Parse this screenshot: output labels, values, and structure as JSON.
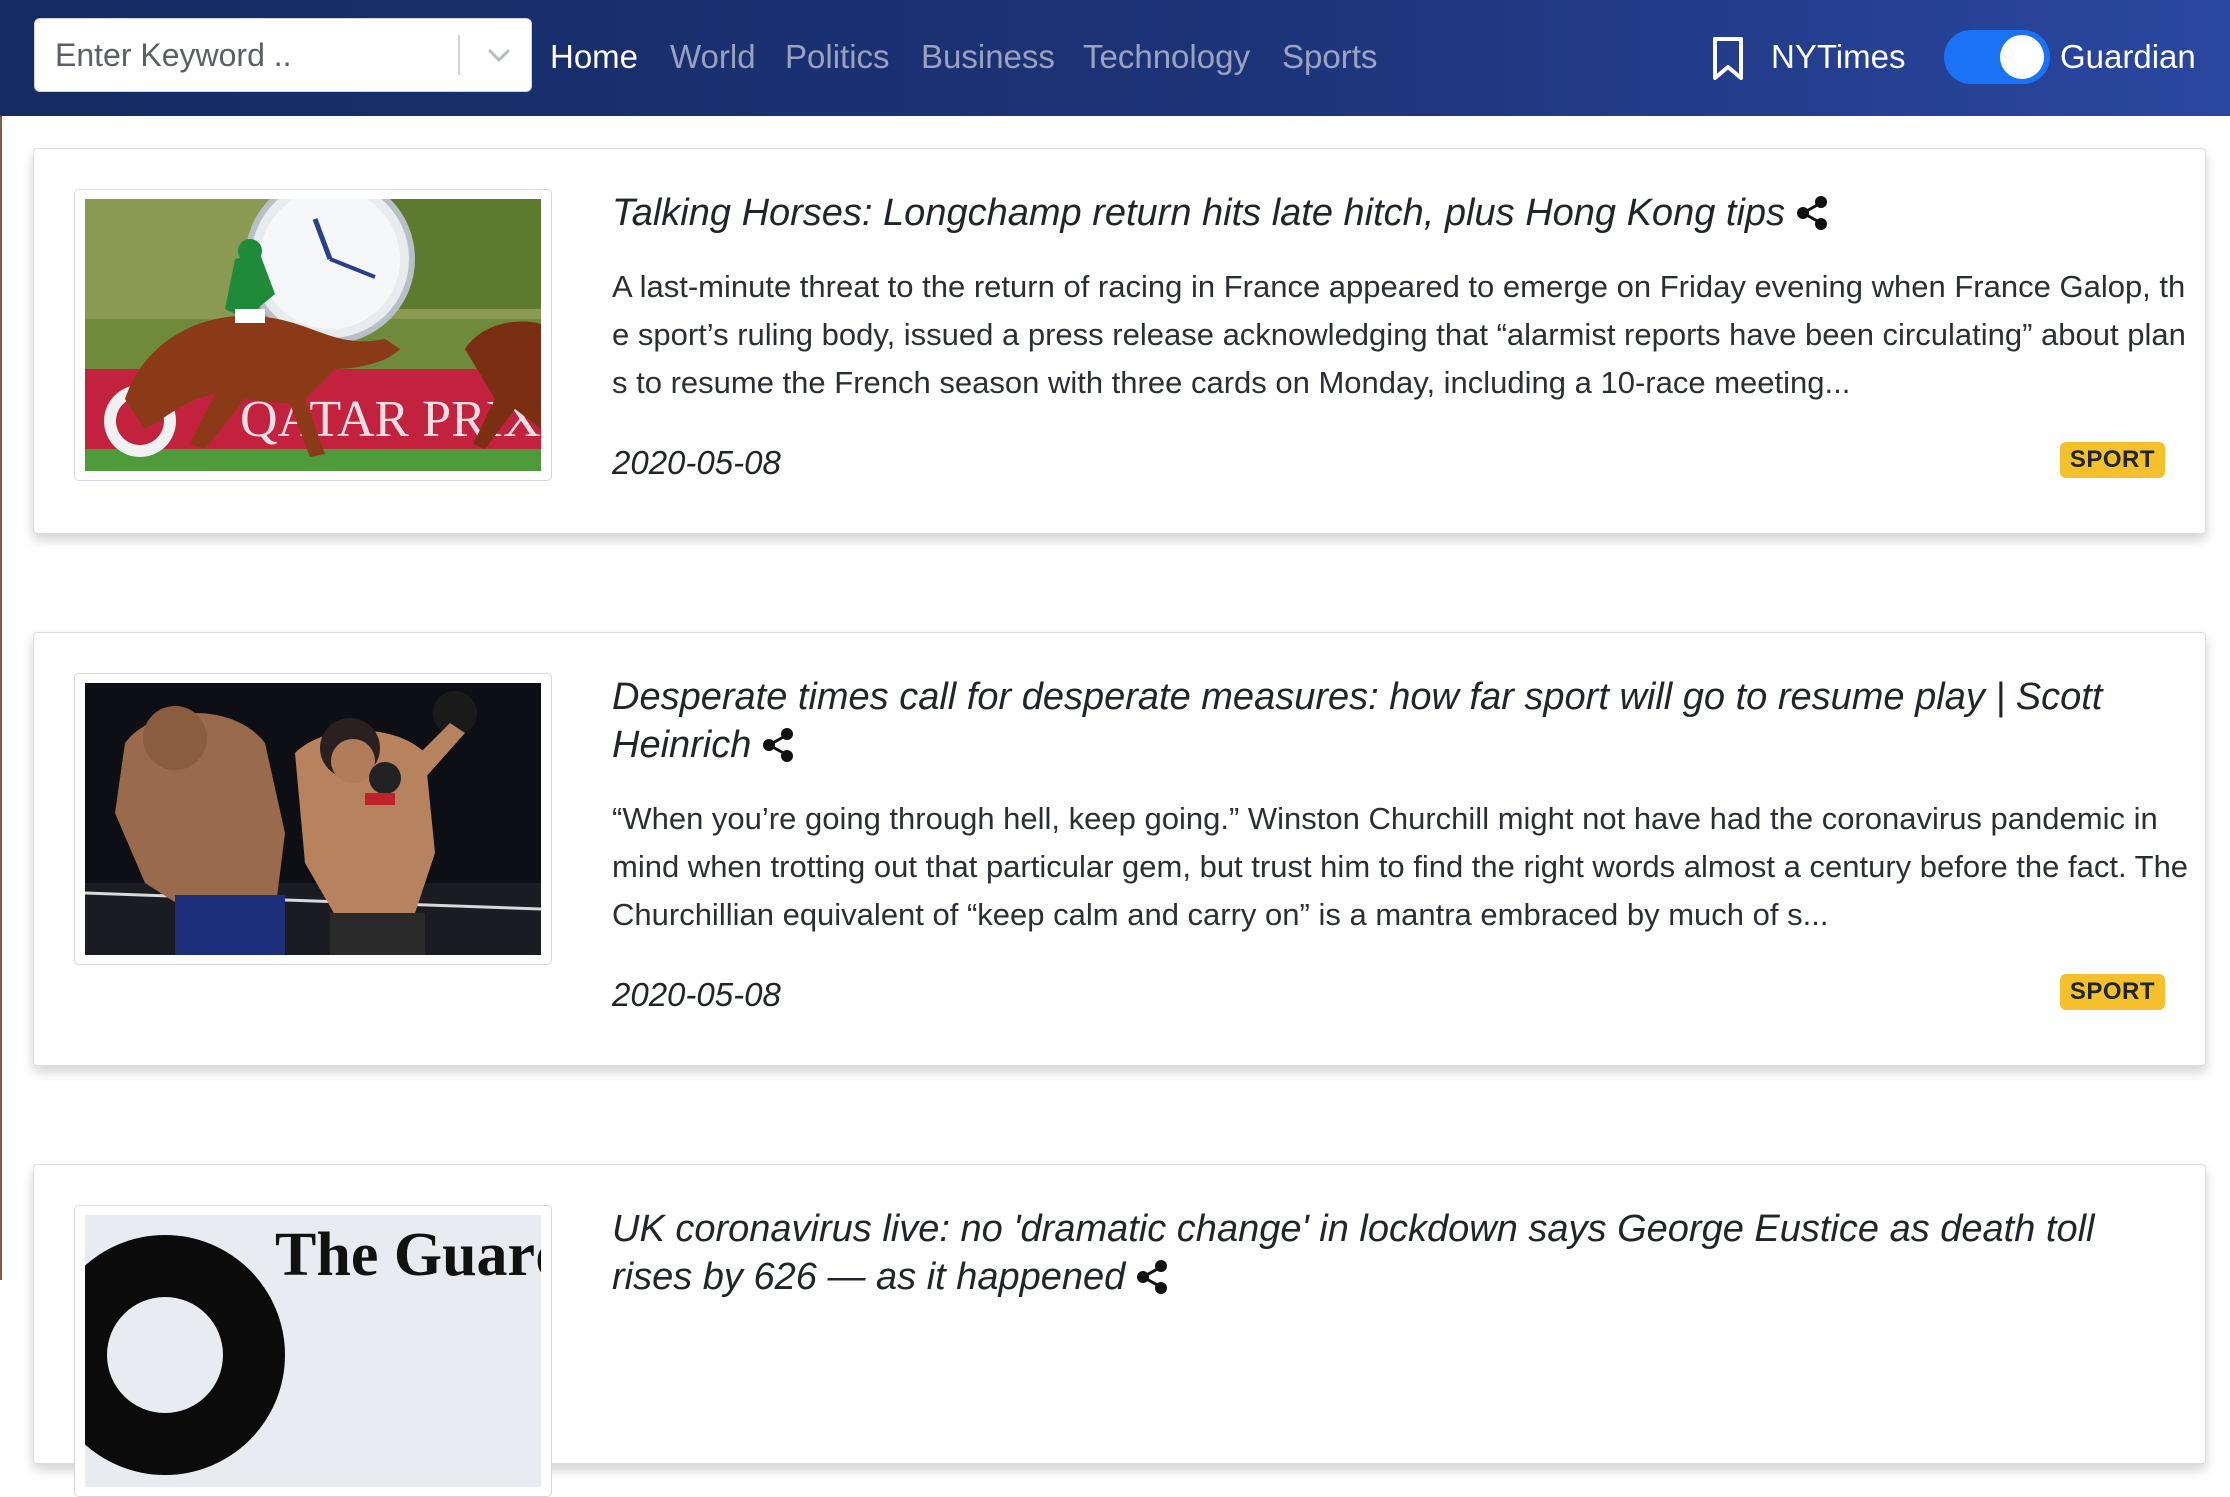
{
  "navbar": {
    "search": {
      "placeholder": "Enter Keyword .."
    },
    "links": [
      {
        "label": "Home",
        "active": true
      },
      {
        "label": "World",
        "active": false
      },
      {
        "label": "Politics",
        "active": false
      },
      {
        "label": "Business",
        "active": false
      },
      {
        "label": "Technology",
        "active": false
      },
      {
        "label": "Sports",
        "active": false
      }
    ],
    "source_left_label": "NYTimes",
    "source_right_label": "Guardian",
    "toggle_on": true
  },
  "articles": [
    {
      "title": "Talking Horses: Longchamp return hits late hitch, plus Hong Kong tips",
      "description": "A last-minute threat to the return of racing in France appeared to emerge on Friday evening when France Galop, the sport’s ruling body, issued a press release acknowledging that “alarmist reports have been circulating” about plans to resume the French season with three cards on Monday, including a 10-race meeting...",
      "date": "2020-05-08",
      "section": "SPORT",
      "image_text": "QATAR PRIX DE"
    },
    {
      "title": "Desperate times call for desperate measures: how far sport will go to resume play | Scott Heinrich",
      "description": "“When you’re going through hell, keep going.” Winston Churchill might not have had the coronavirus pandemic in mind when trotting out that particular gem, but trust him to find the right words almost a century before the fact. The Churchillian equivalent of “keep calm and carry on” is a mantra embraced by much of s...",
      "date": "2020-05-08",
      "section": "SPORT"
    },
    {
      "title": "UK coronavirus live: no 'dramatic change' in lockdown says George Eustice as death toll rises by 626 — as it happened",
      "image_text": "The Guardian"
    }
  ],
  "colors": {
    "navbar_start": "#162a63",
    "navbar_end": "#2a47a0",
    "toggle": "#1a73f5",
    "badge": "#f4c02b"
  }
}
